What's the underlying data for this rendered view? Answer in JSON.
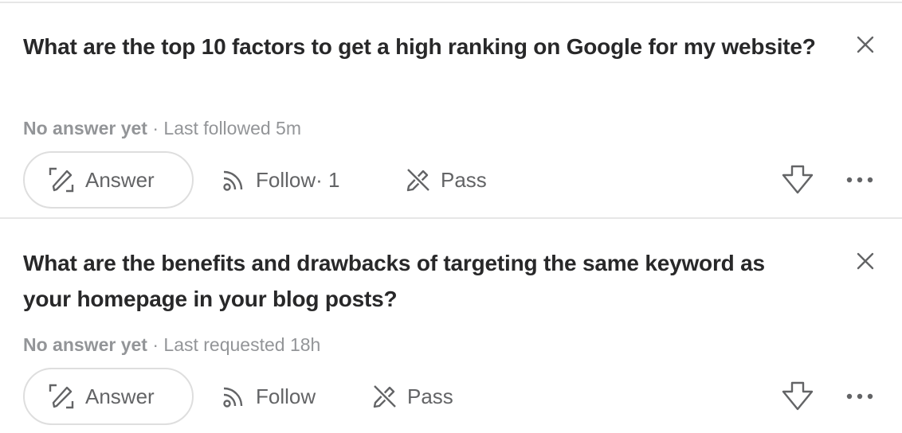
{
  "questions": [
    {
      "title": "What are the top 10 factors to get a high ranking on Google for my website?",
      "status": "No answer yet",
      "separator": " · ",
      "activity": "Last followed 5m",
      "answer_label": "Answer",
      "follow_label": "Follow",
      "follow_count": " · 1",
      "pass_label": "Pass",
      "icons": {
        "close": "close-icon",
        "answer": "pencil-edit-icon",
        "follow": "rss-follow-icon",
        "pass": "pencil-crossed-icon",
        "downvote": "downvote-arrow-icon",
        "more": "more-dots-icon"
      }
    },
    {
      "title": "What are the benefits and drawbacks of targeting the same keyword as your homepage in your blog posts?",
      "status": "No answer yet",
      "separator": " · ",
      "activity": "Last requested 18h",
      "answer_label": "Answer",
      "follow_label": "Follow",
      "follow_count": "",
      "pass_label": "Pass",
      "icons": {
        "close": "close-icon",
        "answer": "pencil-edit-icon",
        "follow": "rss-follow-icon",
        "pass": "pencil-crossed-icon",
        "downvote": "downvote-arrow-icon",
        "more": "more-dots-icon"
      }
    }
  ],
  "colors": {
    "title": "#282829",
    "meta": "#939598",
    "action": "#636466",
    "border": "#dedede"
  }
}
